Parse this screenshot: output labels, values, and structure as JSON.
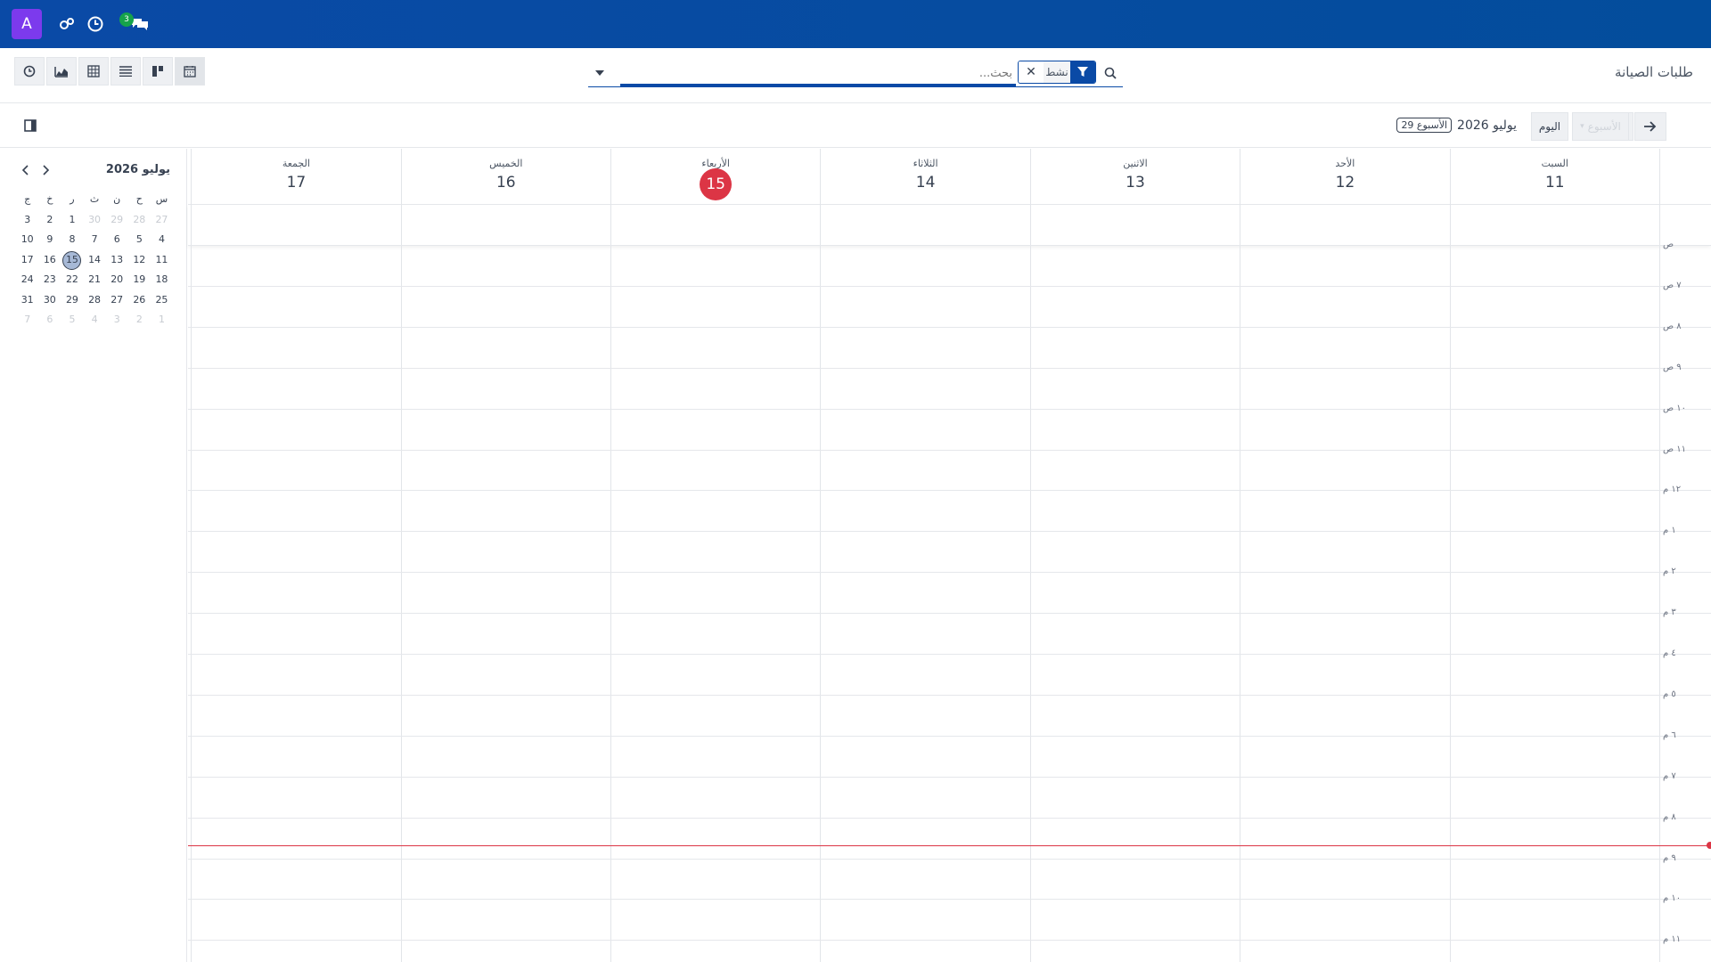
{
  "navbar": {
    "avatar_letter": "A",
    "icons": [
      "settings-icon",
      "clock-icon",
      "chat-icon"
    ],
    "chat_badge": "3",
    "bg_color": "#0a4aa6"
  },
  "control": {
    "breadcrumb": "طلبات الصيانة",
    "views": [
      "activity-view",
      "graph-view",
      "pivot-view",
      "list-view",
      "kanban-view",
      "calendar-view"
    ],
    "search": {
      "placeholder": "بحث...",
      "facet_value": "نشط"
    }
  },
  "toolbar": {
    "today_label": "اليوم",
    "scale_label": "الأسبوع",
    "period_text": "يوليو 2026",
    "week_badge": "الأسبوع 29"
  },
  "mini_calendar": {
    "title": "يوليو 2026",
    "weekday_heads": [
      "س",
      "ح",
      "ن",
      "ث",
      "ر",
      "خ",
      "ج"
    ],
    "weeks": [
      [
        {
          "d": "27",
          "m": 1
        },
        {
          "d": "28",
          "m": 1
        },
        {
          "d": "29",
          "m": 1
        },
        {
          "d": "30",
          "m": 1
        },
        {
          "d": "1"
        },
        {
          "d": "2"
        },
        {
          "d": "3"
        }
      ],
      [
        {
          "d": "4"
        },
        {
          "d": "5"
        },
        {
          "d": "6"
        },
        {
          "d": "7"
        },
        {
          "d": "8"
        },
        {
          "d": "9"
        },
        {
          "d": "10"
        }
      ],
      [
        {
          "d": "11"
        },
        {
          "d": "12"
        },
        {
          "d": "13"
        },
        {
          "d": "14"
        },
        {
          "d": "15",
          "t": 1
        },
        {
          "d": "16"
        },
        {
          "d": "17"
        }
      ],
      [
        {
          "d": "18"
        },
        {
          "d": "19"
        },
        {
          "d": "20"
        },
        {
          "d": "21"
        },
        {
          "d": "22"
        },
        {
          "d": "23"
        },
        {
          "d": "24"
        }
      ],
      [
        {
          "d": "25"
        },
        {
          "d": "26"
        },
        {
          "d": "27"
        },
        {
          "d": "28"
        },
        {
          "d": "29"
        },
        {
          "d": "30"
        },
        {
          "d": "31"
        }
      ],
      [
        {
          "d": "1",
          "m": 1
        },
        {
          "d": "2",
          "m": 1
        },
        {
          "d": "3",
          "m": 1
        },
        {
          "d": "4",
          "m": 1
        },
        {
          "d": "5",
          "m": 1
        },
        {
          "d": "6",
          "m": 1
        },
        {
          "d": "7",
          "m": 1
        }
      ]
    ]
  },
  "week": {
    "days": [
      {
        "name": "السبت",
        "num": "11"
      },
      {
        "name": "الأحد",
        "num": "12"
      },
      {
        "name": "الاثنين",
        "num": "13"
      },
      {
        "name": "الثلاثاء",
        "num": "14"
      },
      {
        "name": "الأربعاء",
        "num": "15",
        "today": true
      },
      {
        "name": "الخميس",
        "num": "16"
      },
      {
        "name": "الجمعة",
        "num": "17"
      }
    ],
    "hours": [
      "ص",
      "٧ ص",
      "٨ ص",
      "٩ ص",
      "١٠ ص",
      "١١ ص",
      "١٢ م",
      "١ م",
      "٢ م",
      "٣ م",
      "٤ م",
      "٥ م",
      "٦ م",
      "٧ م",
      "٨ م",
      "٩ م",
      "١٠ م",
      "١١ م"
    ],
    "today_color": "#dc3545"
  }
}
